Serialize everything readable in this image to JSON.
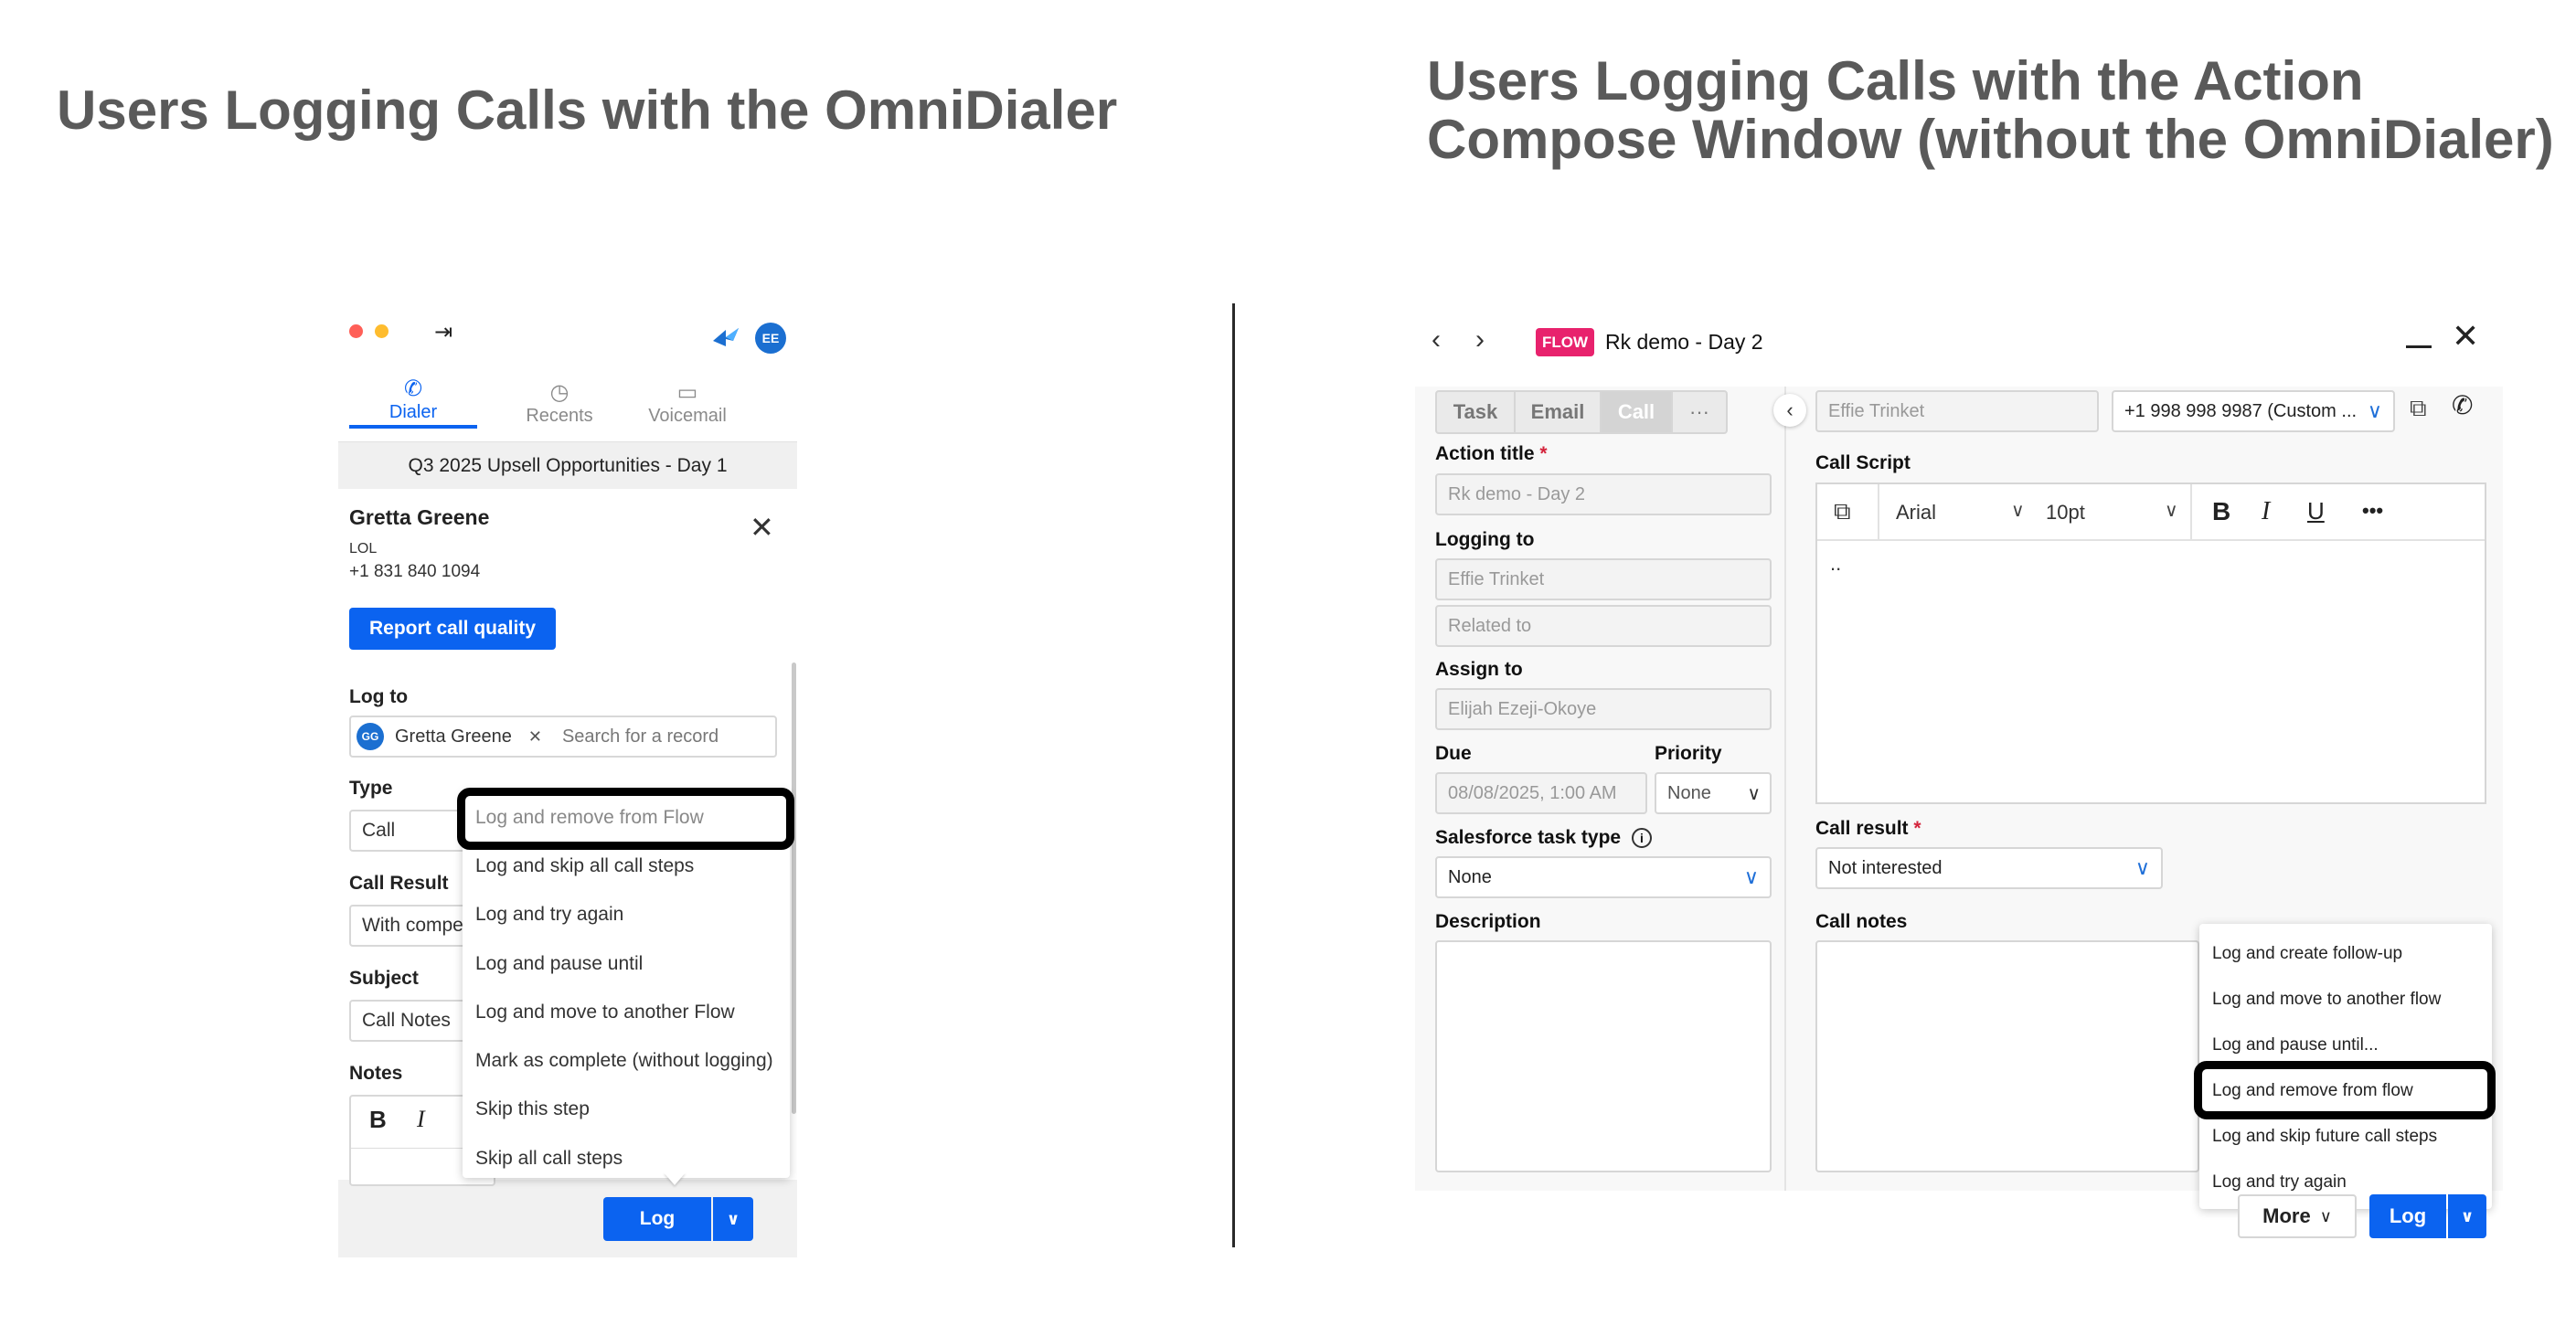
{
  "headings": {
    "left": "Users Logging Calls with the OmniDialer",
    "right_line1": "Users Logging Calls with the Action",
    "right_line2": "Compose Window (without the OmniDialer)"
  },
  "colors": {
    "primary_blue": "#0b63f0",
    "flow_pink": "#e8226d",
    "heading_grey": "#5a5a5a",
    "highlight_black": "#000000"
  },
  "dialer": {
    "avatar_initials": "EE",
    "tabs": [
      {
        "label": "Dialer",
        "icon": "phone-icon",
        "active": true
      },
      {
        "label": "Recents",
        "icon": "clock-icon",
        "active": false
      },
      {
        "label": "Voicemail",
        "icon": "voicemail-icon",
        "active": false
      }
    ],
    "flow_name": "Q3 2025 Upsell Opportunities - Day 1",
    "contact": {
      "name": "Gretta Greene",
      "company": "LOL",
      "phone": "+1 831 840 1094"
    },
    "report_button": "Report call quality",
    "log_to_label": "Log to",
    "log_to_chip": {
      "initials": "GG",
      "name": "Gretta Greene"
    },
    "search_placeholder": "Search for a record",
    "type_label": "Type",
    "type_value": "Call",
    "call_result_label": "Call Result",
    "call_result_value": "With compe",
    "subject_label": "Subject",
    "subject_value": "Call Notes",
    "notes_label": "Notes",
    "notes_toolbar": {
      "bold": "B",
      "italic": "I"
    },
    "menu_items": [
      "Log and remove from Flow",
      "Log and skip all call steps",
      "Log and try again",
      "Log and pause until",
      "Log and move to another Flow",
      "Mark as complete (without logging)",
      "Skip this step",
      "Skip all call steps"
    ],
    "log_button": "Log"
  },
  "compose": {
    "badge": "FLOW",
    "title": "Rk demo - Day 2",
    "tabs": [
      "Task",
      "Email",
      "Call",
      "···"
    ],
    "action_title_label": "Action title",
    "required_mark": "*",
    "action_title_value": "Rk demo - Day 2",
    "logging_to_label": "Logging to",
    "logging_to_value": "Effie Trinket",
    "related_to_placeholder": "Related to",
    "assign_to_label": "Assign to",
    "assign_to_value": "Elijah Ezeji-Okoye",
    "due_label": "Due",
    "due_value": "08/08/2025, 1:00 AM",
    "priority_label": "Priority",
    "priority_value": "None",
    "sf_task_type_label": "Salesforce task type",
    "sf_task_type_value": "None",
    "description_label": "Description",
    "recipient_value": "Effie Trinket",
    "phone_value": "+1 998 998 9987 (Custom ...",
    "call_script_label": "Call Script",
    "font_value": "Arial",
    "size_value": "10pt",
    "editor_toolbar": {
      "bold": "B",
      "italic": "I",
      "underline": "U",
      "more": "•••"
    },
    "script_text": "..",
    "call_result_label": "Call result",
    "call_result_value": "Not interested",
    "call_notes_label": "Call notes",
    "menu_items": [
      "Log and create follow-up",
      "Log and move to another flow",
      "Log and pause until...",
      "Log and remove from flow",
      "Log and skip future call steps",
      "Log and try again"
    ],
    "more_button": "More",
    "log_button": "Log"
  }
}
